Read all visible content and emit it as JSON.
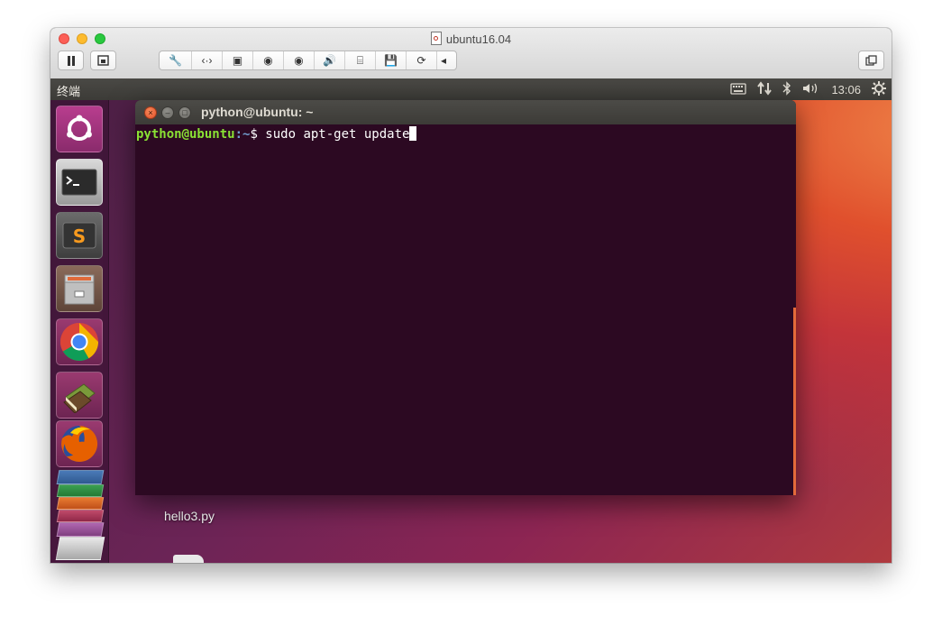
{
  "vm_window": {
    "title": "ubuntu16.04",
    "toolbar": {
      "pause_icon": "pause-icon",
      "snapshot_icon": "snapshot-icon",
      "items": [
        {
          "name": "wrench-icon",
          "glyph": "🔧"
        },
        {
          "name": "network-icon",
          "glyph": "‹·›"
        },
        {
          "name": "hard-disk-icon",
          "glyph": "▣"
        },
        {
          "name": "cd-drive-icon",
          "glyph": "◉"
        },
        {
          "name": "cd-drive-2-icon",
          "glyph": "◉"
        },
        {
          "name": "sound-icon",
          "glyph": "🔊"
        },
        {
          "name": "usb-icon",
          "glyph": "⌸"
        },
        {
          "name": "floppy-icon",
          "glyph": "💾"
        },
        {
          "name": "sync-icon",
          "glyph": "⟳"
        },
        {
          "name": "more-arrow-icon",
          "glyph": "◂"
        }
      ],
      "restore_icon": "restore-window-icon"
    }
  },
  "ubuntu": {
    "panel": {
      "app_title": "终端",
      "indicators": {
        "keyboard_icon": "keyboard-icon",
        "network_icon": "network-arrows-icon",
        "bluetooth_icon": "bluetooth-icon",
        "volume_icon": "volume-icon",
        "clock": "13:06",
        "settings_icon": "gear-icon"
      }
    },
    "launcher": [
      {
        "name": "ubuntu-dash-icon"
      },
      {
        "name": "terminal-icon"
      },
      {
        "name": "sublime-text-icon"
      },
      {
        "name": "file-manager-icon"
      },
      {
        "name": "chrome-icon"
      },
      {
        "name": "books-icon"
      },
      {
        "name": "firefox-icon"
      }
    ],
    "desktop_files": [
      {
        "label": "hello3.py"
      }
    ],
    "terminal": {
      "title": "python@ubuntu: ~",
      "prompt_user": "python@ubuntu",
      "prompt_path": ":~",
      "prompt_symbol": "$ ",
      "command": "sudo apt-get update"
    }
  },
  "colors": {
    "terminal_bg": "#2c0922",
    "prompt_green": "#8ae234",
    "prompt_blue": "#729fcf",
    "close_orange": "#e2532c"
  }
}
